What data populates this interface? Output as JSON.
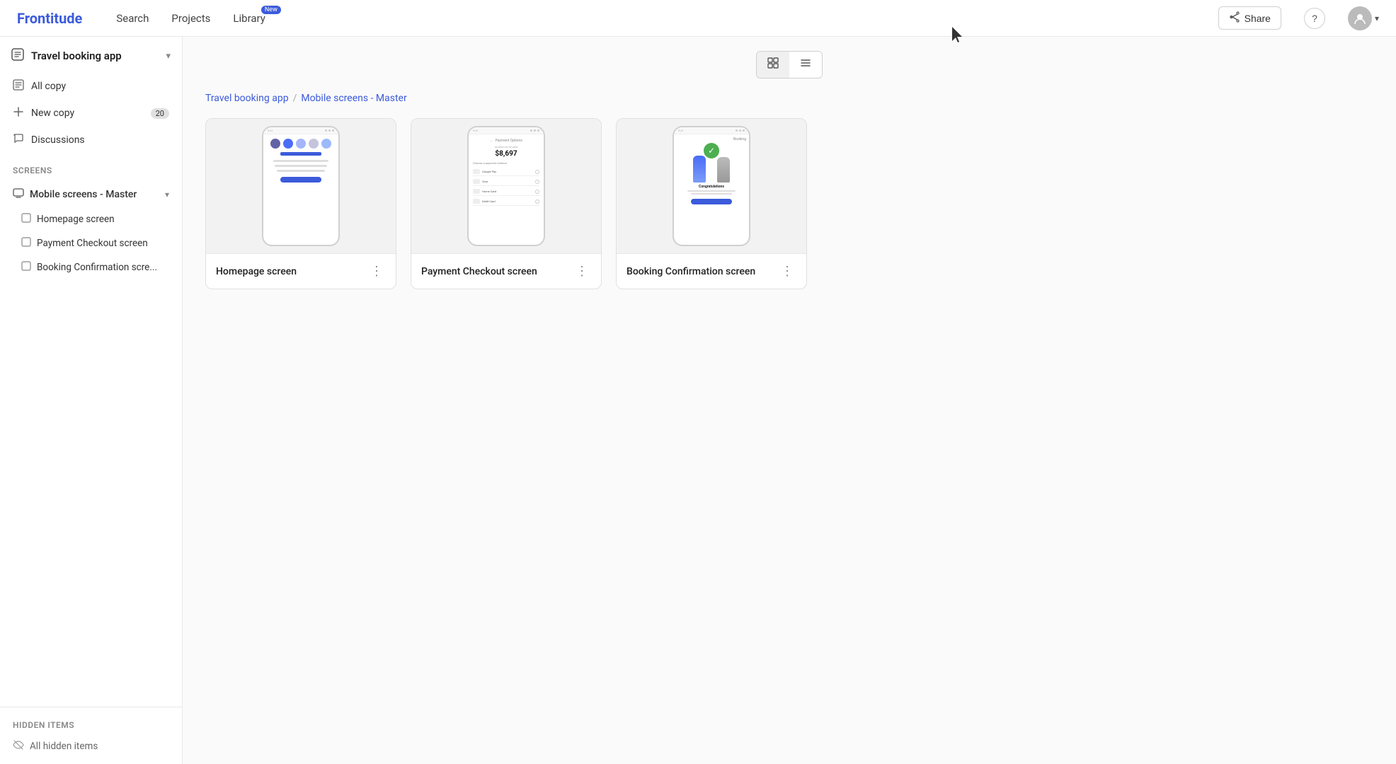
{
  "app": {
    "logo": "Frontitude",
    "nav": {
      "search": "Search",
      "projects": "Projects",
      "library": "Library",
      "library_badge": "New"
    },
    "share_label": "Share",
    "help_tooltip": "?",
    "avatar_initial": ""
  },
  "sidebar": {
    "project_title": "Travel booking app",
    "nav_items": [
      {
        "id": "all-copy",
        "label": "All copy",
        "icon": "☰",
        "count": null
      },
      {
        "id": "new-copy",
        "label": "New copy",
        "icon": "↓",
        "count": "20"
      },
      {
        "id": "discussions",
        "label": "Discussions",
        "icon": "💬",
        "count": null
      }
    ],
    "screens_section": "Screens",
    "screen_group": {
      "label": "Mobile screens - Master",
      "items": [
        {
          "id": "homepage-screen",
          "label": "Homepage screen"
        },
        {
          "id": "payment-checkout-screen",
          "label": "Payment Checkout screen"
        },
        {
          "id": "booking-confirmation-screen",
          "label": "Booking Confirmation scre..."
        }
      ]
    },
    "hidden_section": "Hidden items",
    "hidden_item": "All hidden items"
  },
  "breadcrumb": {
    "project": "Travel booking app",
    "separator": "/",
    "current": "Mobile screens - Master"
  },
  "toolbar": {
    "grid_view_label": "Grid view",
    "list_view_label": "List view"
  },
  "cards": [
    {
      "id": "homepage-screen",
      "label": "Homepage screen"
    },
    {
      "id": "payment-checkout-screen",
      "label": "Payment Checkout screen"
    },
    {
      "id": "booking-confirmation-screen",
      "label": "Booking Confirmation screen"
    }
  ],
  "payment_mockup": {
    "header": "Payment Options",
    "subheader": "Amount to be paid",
    "amount": "$8,697",
    "choose_label": "Choose a payment method",
    "options": [
      "Google Pay",
      "Visa",
      "Home Card",
      "Debit Card"
    ]
  }
}
